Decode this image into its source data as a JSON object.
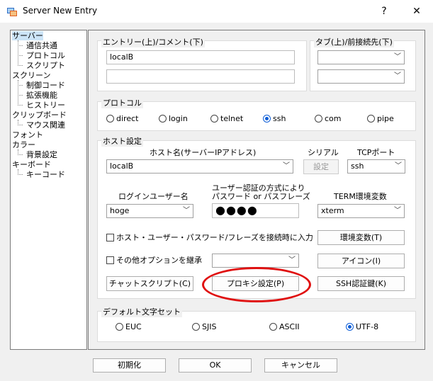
{
  "window": {
    "title": "Server New Entry",
    "help_label": "?",
    "close_label": "✕",
    "icon": "window-app-icon"
  },
  "tree": {
    "items": [
      {
        "label": "サーバー",
        "selected": true
      },
      {
        "label": "通信共通"
      },
      {
        "label": "プロトコル"
      },
      {
        "label": "スクリプト"
      },
      {
        "label": "スクリーン"
      },
      {
        "label": "制御コード"
      },
      {
        "label": "拡張機能"
      },
      {
        "label": "ヒストリー"
      },
      {
        "label": "クリップボード"
      },
      {
        "label": "マウス関連"
      },
      {
        "label": "フォント"
      },
      {
        "label": "カラー"
      },
      {
        "label": "背景設定"
      },
      {
        "label": "キーボード"
      },
      {
        "label": "キーコード"
      }
    ]
  },
  "entry": {
    "group_label": "エントリー(上)/コメント(下)",
    "entry_value": "localB",
    "comment_value": ""
  },
  "tab": {
    "group_label": "タブ(上)/前接続先(下)",
    "tab_value": "",
    "prev_value": ""
  },
  "protocol": {
    "group_label": "プロトコル",
    "options": [
      "direct",
      "login",
      "telnet",
      "ssh",
      "com",
      "pipe"
    ],
    "selected": "ssh"
  },
  "host": {
    "group_label": "ホスト設定",
    "hostname_label": "ホスト名(サーバーIPアドレス)",
    "hostname_value": "localB",
    "serial_label": "シリアル",
    "serial_button": "設定",
    "tcp_port_label": "TCPポート",
    "tcp_port_value": "ssh",
    "login_user_label": "ログインユーザー名",
    "login_user_value": "hoge",
    "auth_label_line1": "ユーザー認証の方式により",
    "auth_label_line2": "パスワード or パスフレーズ",
    "password_mask": "●●●●",
    "term_label": "TERM環境変数",
    "term_value": "xterm",
    "input_on_connect_label": "ホスト・ユーザー・パスワード/フレーズを接続時に入力",
    "env_button": "環境変数(T)",
    "inherit_label": "その他オプションを継承",
    "inherit_value": "",
    "icon_button": "アイコン(I)",
    "chat_button": "チャットスクリプト(C)",
    "proxy_button": "プロキシ設定(P)",
    "ssh_auth_button": "SSH認証鍵(K)"
  },
  "charset": {
    "group_label": "デフォルト文字セット",
    "options": [
      "EUC",
      "SJIS",
      "ASCII",
      "UTF-8"
    ],
    "selected": "UTF-8"
  },
  "footer": {
    "init_button": "初期化",
    "ok_button": "OK",
    "cancel_button": "キャンセル"
  },
  "annotation": {
    "color": "#e01010"
  }
}
